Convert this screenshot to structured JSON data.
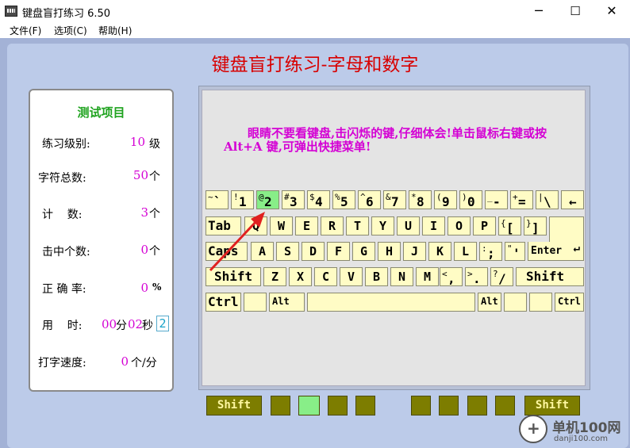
{
  "window": {
    "title": "键盘盲打练习 6.50",
    "minimize": "─",
    "maximize": "☐",
    "close": "✕"
  },
  "menu": [
    "文件(F)",
    "选项(C)",
    "帮助(H)"
  ],
  "heading": "键盘盲打练习-字母和数字",
  "stats": {
    "title": "测试项目",
    "level_label": "练习级别:",
    "level_value": "10",
    "level_unit": "级",
    "total_label": "字符总数:",
    "total_value": "50",
    "total_unit": "个",
    "count_label": "计    数:",
    "count_value": "3",
    "count_unit": "个",
    "hits_label": "击中个数:",
    "hits_value": "0",
    "hits_unit": "个",
    "accuracy_label": "正 确 率:",
    "accuracy_value": "0",
    "accuracy_unit": "%",
    "time_label": "用    时:",
    "time_min": "00",
    "time_min_unit": "分",
    "time_sec": "02",
    "time_sec_unit": "秒",
    "time_box": "2",
    "speed_label": "打字速度:",
    "speed_value": "0",
    "speed_unit": "个/分"
  },
  "hint": "眼睛不要看键盘,击闪烁的键,仔细体会!单击鼠标右键或按 Alt+A 键,可弹出快捷菜单!",
  "keys": {
    "row1": [
      {
        "top": "~",
        "bot": "`"
      },
      {
        "top": "!",
        "bot": "1"
      },
      {
        "top": "@",
        "bot": "2",
        "lit": true
      },
      {
        "top": "#",
        "bot": "3"
      },
      {
        "top": "$",
        "bot": "4"
      },
      {
        "top": "%",
        "bot": "5"
      },
      {
        "top": "^",
        "bot": "6"
      },
      {
        "top": "&",
        "bot": "7"
      },
      {
        "top": "*",
        "bot": "8"
      },
      {
        "top": "(",
        "bot": "9"
      },
      {
        "top": ")",
        "bot": "0"
      },
      {
        "top": "_",
        "bot": "-"
      },
      {
        "top": "+",
        "bot": "="
      },
      {
        "top": "|",
        "bot": "\\"
      },
      {
        "top": "",
        "bot": "←"
      }
    ],
    "row2_first": "Tab",
    "row2": [
      "Q",
      "W",
      "E",
      "R",
      "T",
      "Y",
      "U",
      "I",
      "O",
      "P"
    ],
    "row2_br1": {
      "top": "{",
      "bot": "["
    },
    "row2_br2": {
      "top": "}",
      "bot": "]"
    },
    "row3_first": "Caps",
    "row3": [
      "A",
      "S",
      "D",
      "F",
      "G",
      "H",
      "J",
      "K",
      "L"
    ],
    "row3_p1": {
      "top": ":",
      "bot": ";"
    },
    "row3_p2": {
      "top": "\"",
      "bot": "'"
    },
    "enter": "Enter",
    "row4_shift_l": "Shift",
    "row4": [
      "Z",
      "X",
      "C",
      "V",
      "B",
      "N",
      "M"
    ],
    "row4_p1": {
      "top": "<",
      "bot": ","
    },
    "row4_p2": {
      "top": ">",
      "bot": "."
    },
    "row4_p3": {
      "top": "?",
      "bot": "/"
    },
    "row4_shift_r": "Shift",
    "ctrl_l": "Ctrl",
    "alt_l": "Alt",
    "alt_r": "Alt",
    "ctrl_r": "Ctrl"
  },
  "fingers": {
    "shift_l": "Shift",
    "shift_r": "Shift"
  },
  "watermark": {
    "name": "单机100网",
    "url": "danji100.com"
  }
}
